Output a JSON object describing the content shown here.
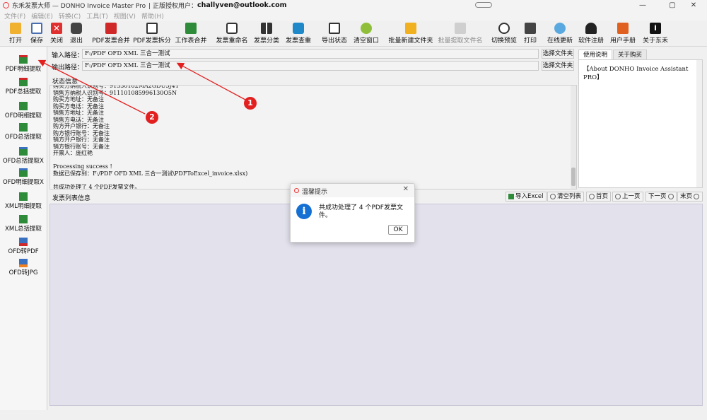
{
  "window": {
    "app_title": "东禾发票大师 — DONHO Invoice Master Pro",
    "license_text": "| 正版授权用户：",
    "user_email": "challyven@outlook.com",
    "buttons": {
      "minimize": "—",
      "maximize": "▢",
      "close": "✕"
    }
  },
  "menu": [
    "文件(F)",
    "编辑(E)",
    "转换(C)",
    "工具(T)",
    "视图(V)",
    "帮助(H)"
  ],
  "toolbar": [
    {
      "label": "打开",
      "icon": "folder-open-icon",
      "color": "#f0a020"
    },
    {
      "label": "保存",
      "icon": "save-icon",
      "color": "#4a6fb0"
    },
    {
      "label": "关闭",
      "icon": "close-icon",
      "color": "#e03030"
    },
    {
      "label": "退出",
      "icon": "exit-icon",
      "color": "#333333"
    },
    {
      "label": "PDF发票合并",
      "icon": "pdf-merge-icon",
      "color": "#d02828"
    },
    {
      "label": "PDF发票拆分",
      "icon": "pdf-split-icon",
      "color": "#333333"
    },
    {
      "label": "工作表合并",
      "icon": "sheet-merge-icon",
      "color": "#2e8b3a"
    },
    {
      "label": "发票重命名",
      "icon": "rename-icon",
      "color": "#333333"
    },
    {
      "label": "发票分类",
      "icon": "grid-icon",
      "color": "#333333"
    },
    {
      "label": "发票查重",
      "icon": "search-duplicate-icon",
      "color": "#1e88c8"
    },
    {
      "label": "导出状态",
      "icon": "export-icon",
      "color": "#333333"
    },
    {
      "label": "清空窗口",
      "icon": "clear-icon",
      "color": "#7fb33a"
    },
    {
      "label": "批量新建文件夹",
      "icon": "new-folder-icon",
      "color": "#f0b020"
    },
    {
      "label": "批量提取文件名",
      "icon": "extract-filename-icon",
      "color": "#bbbbbb"
    },
    {
      "label": "切换预览",
      "icon": "toggle-preview-icon",
      "color": "#333333"
    },
    {
      "label": "打印",
      "icon": "print-icon",
      "color": "#333333"
    },
    {
      "label": "在线更新",
      "icon": "update-icon",
      "color": "#1e88c8"
    },
    {
      "label": "软件注册",
      "icon": "register-icon",
      "color": "#222222"
    },
    {
      "label": "用户手册",
      "icon": "manual-icon",
      "color": "#e06020"
    },
    {
      "label": "关于东禾",
      "icon": "about-icon",
      "color": "#111111"
    }
  ],
  "sidebar": [
    {
      "label": "PDF明细提取",
      "icon": "excel-icon"
    },
    {
      "label": "PDF总括提取",
      "icon": "excel-icon"
    },
    {
      "label": "OFD明细提取",
      "icon": "excel-icon"
    },
    {
      "label": "OFD总括提取",
      "icon": "excel-icon"
    },
    {
      "label": "OFD总括提取X",
      "icon": "excel-icon"
    },
    {
      "label": "OFD明细提取X",
      "icon": "excel-icon"
    },
    {
      "label": "XML明细提取",
      "icon": "excel-icon"
    },
    {
      "label": "XML总括提取",
      "icon": "excel-icon"
    },
    {
      "label": "OFD转PDF",
      "icon": "pdf-convert-icon"
    },
    {
      "label": "OFD转JPG",
      "icon": "jpg-convert-icon"
    }
  ],
  "paths": {
    "input_label": "输入路径：",
    "input_value": "F:/PDF OFD XML 三合一测试",
    "output_label": "输出路径：",
    "output_value": "F:/PDF OFD XML 三合一测试",
    "browse_label": "选择文件夹"
  },
  "status": {
    "title": "状态信息",
    "text": "购买方纳税人识别号：91330102MA2GDU5J4Y\n销售方纳税人识别号：911101085996130O5N\n购买方地址：无备注\n购买方电话：无备注\n销售方地址：无备注\n销售方电话：无备注\n购方开户银行：无备注\n购方银行账号：无备注\n销方开户银行：无备注\n销方银行账号：无备注\n开票人：庞红艳\n\nProcessing success !\n数据已保存到：F:/PDF OFD XML 三合一测试\\PDFToExcel_invoice.xlsx)\n\n共成功处理了 4 个PDF发票文件。"
  },
  "right_panel": {
    "tabs": [
      "使用说明",
      "关于购买"
    ],
    "about": "【About DONHO Invoice Assistant PRO】"
  },
  "invoice_list": {
    "title": "发票列表信息",
    "buttons": [
      "导入Excel",
      "清空列表",
      "首页",
      "上一页",
      "下一页",
      "末页"
    ]
  },
  "dialog": {
    "title": "温馨提示",
    "message": "共成功处理了 4 个PDF发票文件。",
    "ok": "OK"
  },
  "annotations": {
    "badge1": "1",
    "badge2": "2",
    "arrow_color": "#e32020"
  }
}
